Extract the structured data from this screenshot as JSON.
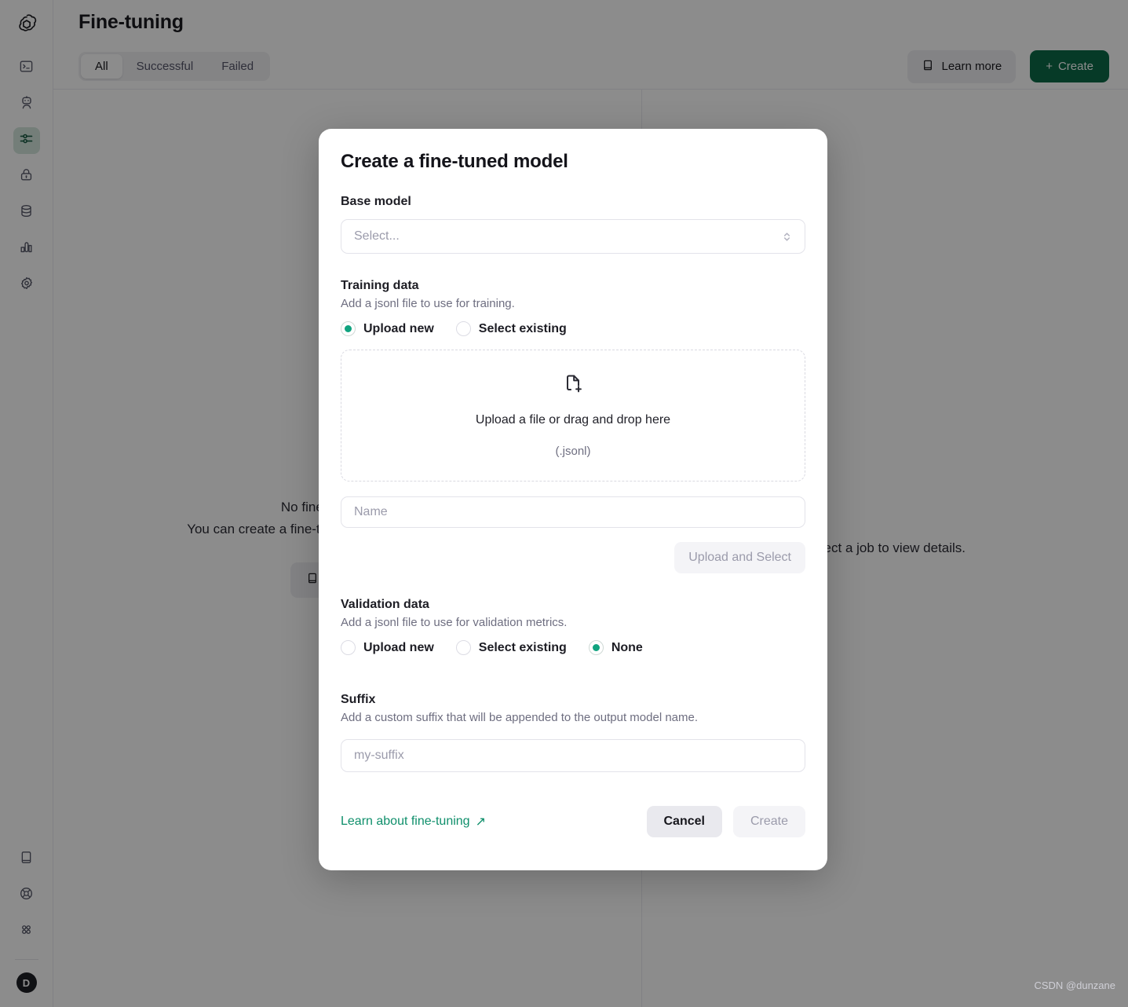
{
  "sidebar": {
    "logo_icon": "openai-logo-icon",
    "top_items": [
      {
        "icon": "terminal-icon",
        "name": "playground",
        "active": false
      },
      {
        "icon": "robot-icon",
        "name": "assistants",
        "active": false
      },
      {
        "icon": "sliders-icon",
        "name": "fine-tuning",
        "active": true
      },
      {
        "icon": "lock-icon",
        "name": "api-keys",
        "active": false
      },
      {
        "icon": "database-icon",
        "name": "storage",
        "active": false
      },
      {
        "icon": "bar-chart-icon",
        "name": "usage",
        "active": false
      },
      {
        "icon": "gear-icon",
        "name": "settings",
        "active": false
      }
    ],
    "bottom_items": [
      {
        "icon": "book-icon",
        "name": "docs"
      },
      {
        "icon": "lifebuoy-icon",
        "name": "help"
      },
      {
        "icon": "grid-icon",
        "name": "apps"
      }
    ],
    "avatar_initial": "D"
  },
  "header": {
    "title": "Fine-tuning",
    "tabs": [
      {
        "label": "All",
        "active": true
      },
      {
        "label": "Successful",
        "active": false
      },
      {
        "label": "Failed",
        "active": false
      }
    ],
    "learn_more_label": "Learn more",
    "create_label": "Create",
    "create_plus": "+"
  },
  "background": {
    "empty_title": "No fine-tuning jobs yet",
    "empty_subtitle": "You can create a fine-tuning job to customize a model.",
    "empty_button_label": "Learn more",
    "detail_placeholder": "Select a job to view details."
  },
  "modal": {
    "title": "Create a fine-tuned model",
    "base_model": {
      "label": "Base model",
      "placeholder": "Select..."
    },
    "training_data": {
      "label": "Training data",
      "help": "Add a jsonl file to use for training.",
      "options": [
        {
          "label": "Upload new",
          "checked": true
        },
        {
          "label": "Select existing",
          "checked": false
        }
      ],
      "dropzone_icon": "file-plus-icon",
      "dropzone_main": "Upload a file or drag and drop here",
      "dropzone_sub": "(.jsonl)",
      "name_placeholder": "Name",
      "upload_button_label": "Upload and Select"
    },
    "validation_data": {
      "label": "Validation data",
      "help": "Add a jsonl file to use for validation metrics.",
      "options": [
        {
          "label": "Upload new",
          "checked": false
        },
        {
          "label": "Select existing",
          "checked": false
        },
        {
          "label": "None",
          "checked": true
        }
      ]
    },
    "suffix": {
      "label": "Suffix",
      "help": "Add a custom suffix that will be appended to the output model name.",
      "placeholder": "my-suffix"
    },
    "footer": {
      "link_label": "Learn about fine-tuning",
      "link_arrow": "↗",
      "cancel_label": "Cancel",
      "create_label": "Create"
    }
  },
  "watermark": "CSDN @dunzane",
  "colors": {
    "accent_green": "#10a37f",
    "create_button_green": "#0c6b48",
    "link_green": "#0f8f6b",
    "sidebar_active_bg": "#d3e5dc"
  }
}
